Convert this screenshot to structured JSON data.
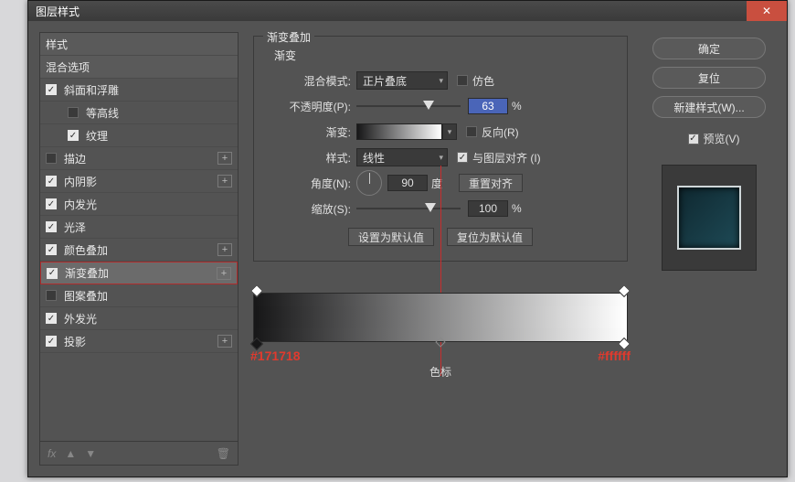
{
  "title": "图层样式",
  "styles": {
    "header": "样式",
    "blend_header": "混合选项",
    "items": [
      {
        "label": "斜面和浮雕",
        "checked": true,
        "plus": false,
        "sub": false
      },
      {
        "label": "等高线",
        "checked": false,
        "plus": false,
        "sub": true
      },
      {
        "label": "纹理",
        "checked": true,
        "plus": false,
        "sub": true
      },
      {
        "label": "描边",
        "checked": false,
        "plus": true,
        "sub": false
      },
      {
        "label": "内阴影",
        "checked": true,
        "plus": true,
        "sub": false
      },
      {
        "label": "内发光",
        "checked": true,
        "plus": false,
        "sub": false
      },
      {
        "label": "光泽",
        "checked": true,
        "plus": false,
        "sub": false
      },
      {
        "label": "颜色叠加",
        "checked": true,
        "plus": true,
        "sub": false
      },
      {
        "label": "渐变叠加",
        "checked": true,
        "plus": true,
        "sub": false,
        "selected": true
      },
      {
        "label": "图案叠加",
        "checked": false,
        "plus": false,
        "sub": false
      },
      {
        "label": "外发光",
        "checked": true,
        "plus": false,
        "sub": false
      },
      {
        "label": "投影",
        "checked": true,
        "plus": true,
        "sub": false
      }
    ],
    "fx_label": "fx"
  },
  "panel": {
    "legend": "渐变叠加",
    "sub_legend": "渐变",
    "blend_mode_label": "混合模式:",
    "blend_mode_value": "正片叠底",
    "dither_label": "仿色",
    "opacity_label": "不透明度(P):",
    "opacity_value": "63",
    "percent": "%",
    "gradient_label": "渐变:",
    "reverse_label": "反向(R)",
    "style_label": "样式:",
    "style_value": "线性",
    "align_label": "与图层对齐 (I)",
    "angle_label": "角度(N):",
    "angle_value": "90",
    "degree": "度",
    "reset_align": "重置对齐",
    "scale_label": "缩放(S):",
    "scale_value": "100",
    "set_default": "设置为默认值",
    "reset_default": "复位为默认值",
    "stop_left": "#171718",
    "stop_right": "#ffffff",
    "stops_label": "色标"
  },
  "right": {
    "ok": "确定",
    "cancel": "复位",
    "new_style": "新建样式(W)...",
    "preview": "预览(V)"
  }
}
